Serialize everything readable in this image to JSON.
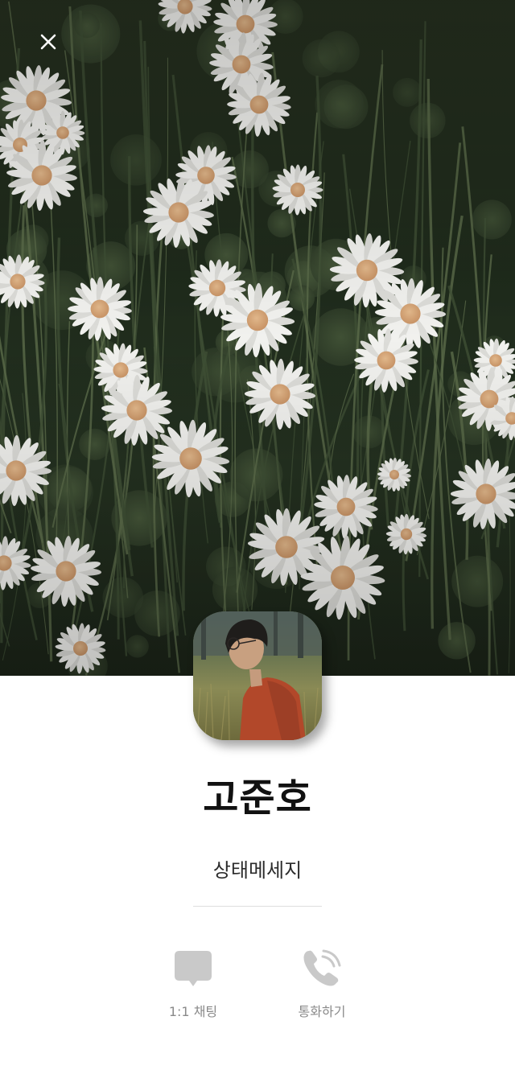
{
  "profile": {
    "name": "고준호",
    "status_message": "상태메세지"
  },
  "actions": {
    "chat_label": "1:1 채팅",
    "call_label": "통화하기"
  },
  "icons": {
    "close": "close-icon",
    "chat": "chat-bubble-icon",
    "call": "phone-call-icon"
  },
  "colors": {
    "icon_gray": "#c9c9c9",
    "label_gray": "#8a8a8a",
    "name_text": "#111111"
  }
}
